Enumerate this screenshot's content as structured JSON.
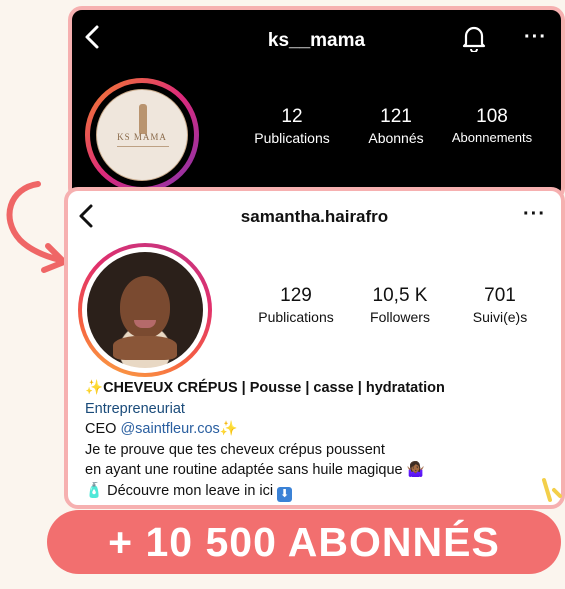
{
  "profile_top": {
    "username": "ks__mama",
    "logo_text": "KS MAMA",
    "stats": [
      {
        "value": "12",
        "label": "Publications"
      },
      {
        "value": "121",
        "label": "Abonnés"
      },
      {
        "value": "108",
        "label": "Abonnements"
      }
    ]
  },
  "profile_bottom": {
    "username": "samantha.hairafro",
    "stats": [
      {
        "value": "129",
        "label": "Publications"
      },
      {
        "value": "10,5 K",
        "label": "Followers"
      },
      {
        "value": "701",
        "label": "Suivi(e)s"
      }
    ],
    "bio": {
      "headline": "CHEVEUX CRÉPUS | Pousse | casse | hydratation",
      "category": "Entrepreneuriat",
      "ceo_prefix": "CEO ",
      "mention": "@saintfleur.cos",
      "line1": "Je te prouve que tes cheveux crépus poussent",
      "line2": "en ayant une routine adaptée sans huile magique",
      "line3": "Découvre mon leave in ici"
    }
  },
  "banner": {
    "text": "+ 10 500 ABONNÉS"
  },
  "colors": {
    "accent": "#f26f6f",
    "border": "#f6b0b0",
    "background": "#fbf5ee"
  }
}
